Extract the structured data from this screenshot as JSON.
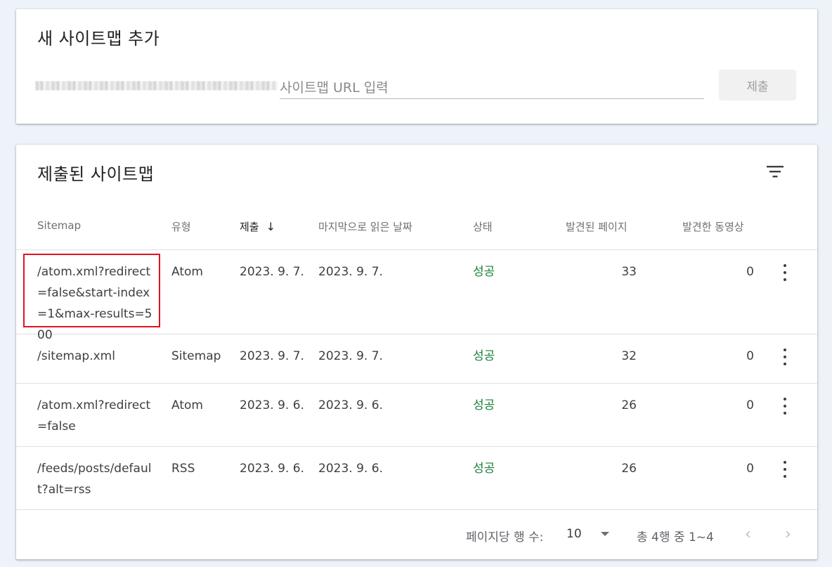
{
  "add_sitemap": {
    "title": "새 사이트맵 추가",
    "url_placeholder": "사이트맵 URL 입력",
    "url_value": "",
    "submit_label": "제출"
  },
  "submitted": {
    "title": "제출된 사이트맵",
    "headers": {
      "sitemap": "Sitemap",
      "type": "유형",
      "submitted": "제출",
      "last_read": "마지막으로 읽은 날짜",
      "status": "상태",
      "pages_found": "발견된 페이지",
      "videos_found": "발견한 동영상"
    },
    "rows": [
      {
        "path": "/atom.xml?redirect=false&start-index=1&max-results=500",
        "type": "Atom",
        "submitted": "2023. 9. 7.",
        "last_read": "2023. 9. 7.",
        "status": "성공",
        "pages": "33",
        "videos": "0"
      },
      {
        "path": "/sitemap.xml",
        "type": "Sitemap",
        "submitted": "2023. 9. 7.",
        "last_read": "2023. 9. 7.",
        "status": "성공",
        "pages": "32",
        "videos": "0"
      },
      {
        "path": "/atom.xml?redirect=false",
        "type": "Atom",
        "submitted": "2023. 9. 6.",
        "last_read": "2023. 9. 6.",
        "status": "성공",
        "pages": "26",
        "videos": "0"
      },
      {
        "path": "/feeds/posts/default?alt=rss",
        "type": "RSS",
        "submitted": "2023. 9. 6.",
        "last_read": "2023. 9. 6.",
        "status": "성공",
        "pages": "26",
        "videos": "0"
      }
    ],
    "footer": {
      "rows_per_page_label": "페이지당 행 수:",
      "rows_per_page_value": "10",
      "range_text": "총 4행 중 1~4"
    }
  },
  "colors": {
    "background": "#eef2f9",
    "status_success": "#188038",
    "highlight_border": "#e0141e"
  },
  "icons": [
    "filter-icon",
    "sort-arrow-down-icon",
    "more-vert-icon",
    "caret-down-icon",
    "chevron-left-icon",
    "chevron-right-icon"
  ]
}
